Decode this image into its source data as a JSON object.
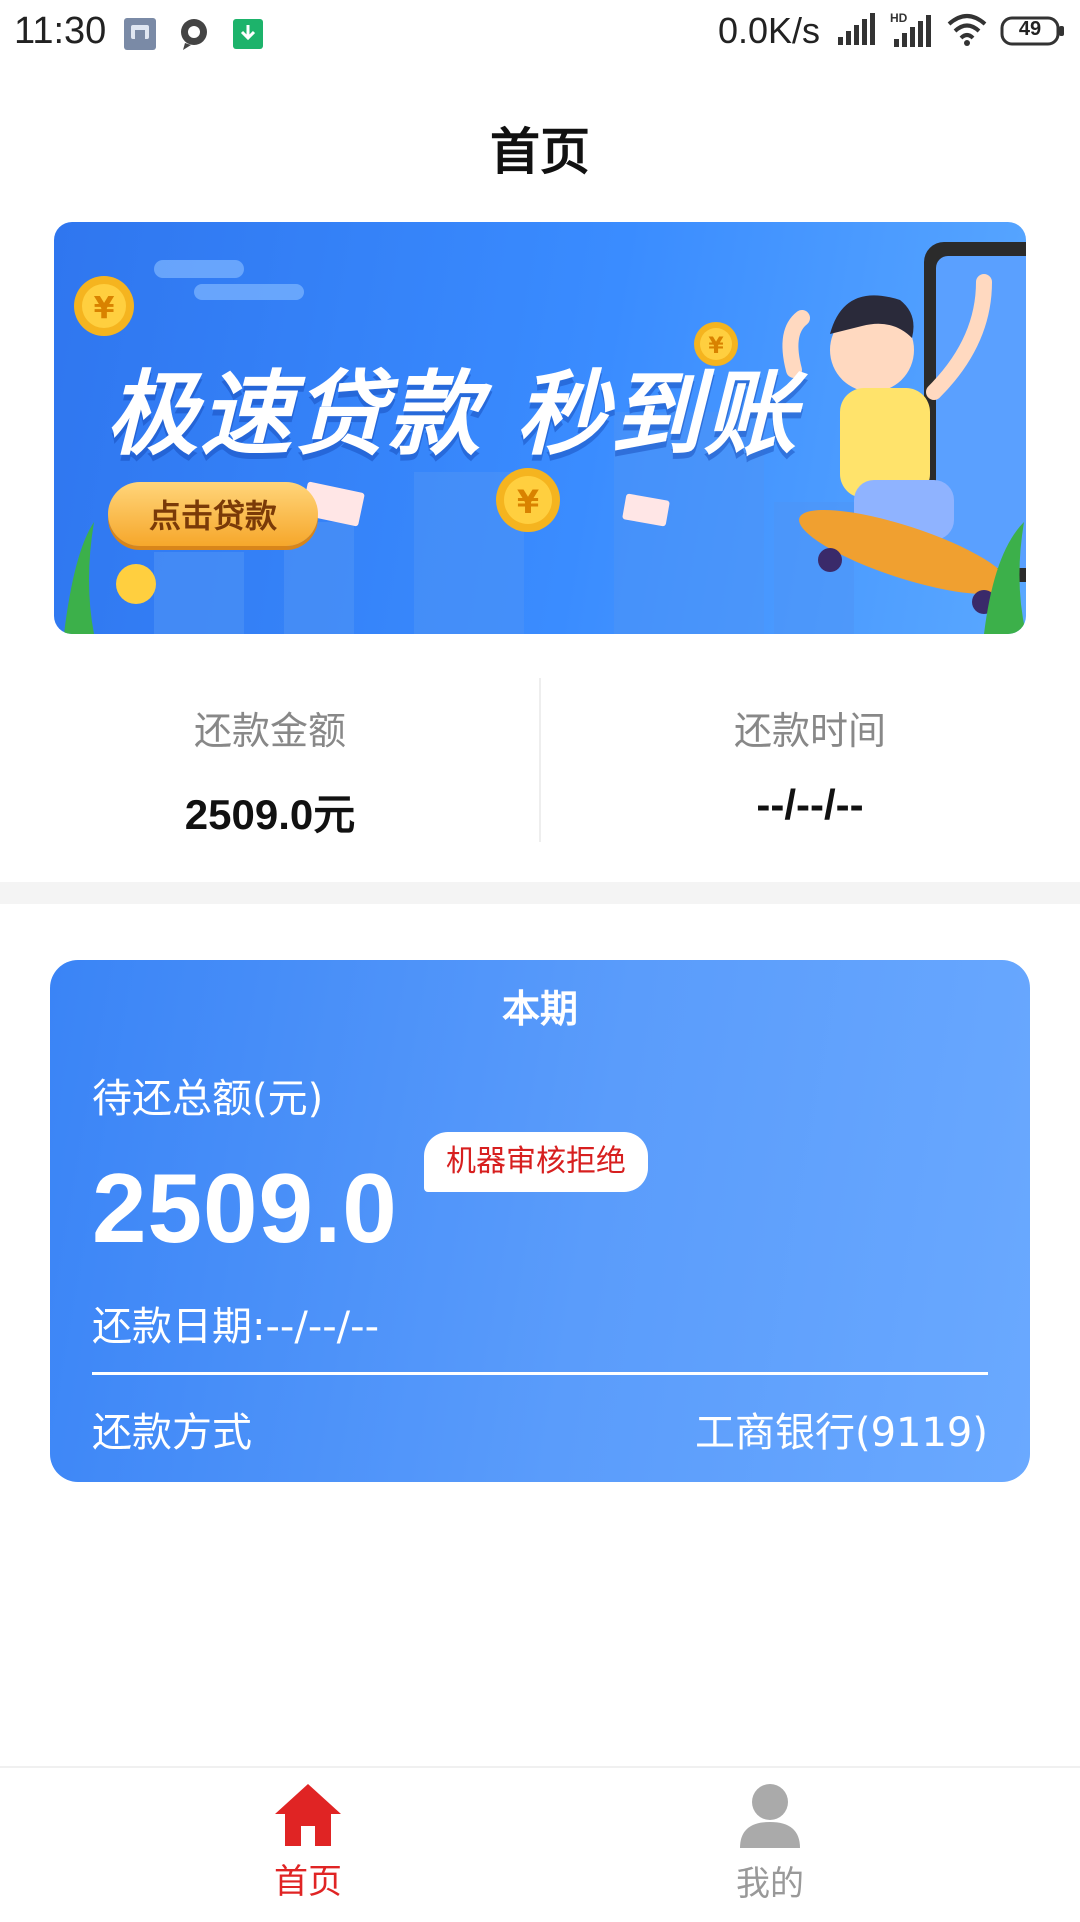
{
  "status_bar": {
    "time": "11:30",
    "net_speed": "0.0K/s",
    "battery": "49",
    "icons": [
      "gallery-icon",
      "chat-bubble-icon",
      "download-icon",
      "signal-icon",
      "hd-signal-icon",
      "wifi-icon",
      "battery-icon"
    ]
  },
  "page": {
    "title": "首页"
  },
  "banner": {
    "headline": "极速贷款 秒到账",
    "cta_label": "点击贷款",
    "colors": {
      "bg_start": "#2f76ef",
      "bg_end": "#5aa8ff",
      "coin": "#f5b41f"
    }
  },
  "summary": {
    "repay_amount_label": "还款金额",
    "repay_amount_value": "2509.0元",
    "repay_time_label": "还款时间",
    "repay_time_value": "--/--/--"
  },
  "current_period": {
    "title": "本期",
    "total_label": "待还总额(元)",
    "total_value": "2509.0",
    "status_badge": "机器审核拒绝",
    "due_date": "还款日期:--/--/--",
    "method_label": "还款方式",
    "method_value": "工商银行(9119)",
    "colors": {
      "card_start": "#3a84f6",
      "card_end": "#6aa9ff",
      "badge_text": "#d71f1f"
    }
  },
  "bottom_nav": {
    "items": [
      {
        "label": "首页",
        "icon": "home-icon",
        "active": true
      },
      {
        "label": "我的",
        "icon": "user-icon",
        "active": false
      }
    ],
    "colors": {
      "active": "#e02424",
      "inactive": "#999999"
    }
  }
}
